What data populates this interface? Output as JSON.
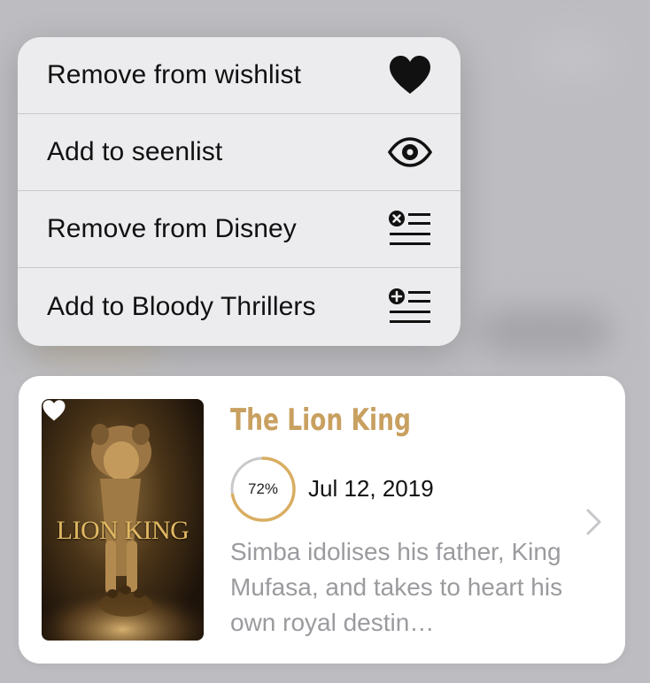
{
  "context_menu": {
    "items": [
      {
        "label": "Remove from wishlist",
        "icon": "heart-filled-icon"
      },
      {
        "label": "Add to seenlist",
        "icon": "eye-icon"
      },
      {
        "label": "Remove from Disney",
        "icon": "list-remove-icon"
      },
      {
        "label": "Add to Bloody Thrillers",
        "icon": "list-add-icon"
      }
    ]
  },
  "movie": {
    "poster_title": "LION KING",
    "poster_icon": "heart-icon",
    "title": "The Lion King",
    "rating_percent": 72,
    "rating_label": "72%",
    "release_date": "Jul 12, 2019",
    "overview": "Simba idolises his father, King Mufasa, and takes to heart his own royal destin…",
    "chevron_icon": "chevron-right-icon"
  },
  "colors": {
    "background": "#bdbdc1",
    "menu_background": "#ececee",
    "title_accent": "#c8a060",
    "rating_ring": "#d9ae62",
    "overview_text": "#9b9b9f"
  }
}
